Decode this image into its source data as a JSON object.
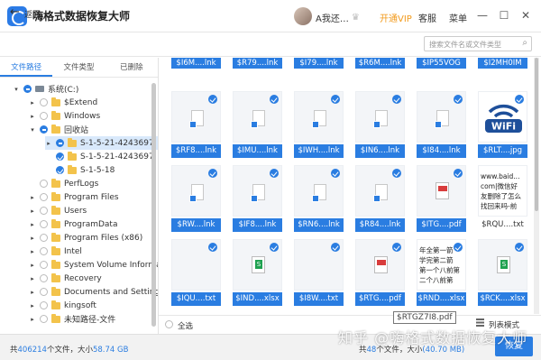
{
  "app": {
    "title": "嗨格式数据恢复大师",
    "user": "A我还…",
    "vip": "开通VIP",
    "service": "客服",
    "menu": "菜单"
  },
  "window": {
    "minimize": "—",
    "restore": "☐",
    "close": "✕"
  },
  "nav": {
    "back_label": "返回",
    "search_placeholder": "搜索文件名或文件类型"
  },
  "sidebar": {
    "tabs": [
      {
        "label": "文件路径"
      },
      {
        "label": "文件类型"
      },
      {
        "label": "已删除"
      }
    ],
    "tree": [
      {
        "label": "系统(C:)"
      },
      {
        "label": "$Extend"
      },
      {
        "label": "Windows"
      },
      {
        "label": "回收站"
      },
      {
        "label": "S-1-5-21-4243697"
      },
      {
        "label": "S-1-5-21-4243697"
      },
      {
        "label": "S-1-5-18"
      },
      {
        "label": "PerfLogs"
      },
      {
        "label": "Program Files"
      },
      {
        "label": "Users"
      },
      {
        "label": "ProgramData"
      },
      {
        "label": "Program Files (x86)"
      },
      {
        "label": "Intel"
      },
      {
        "label": "System Volume Informa"
      },
      {
        "label": "Recovery"
      },
      {
        "label": "Documents and Settings"
      },
      {
        "label": "kingsoft"
      },
      {
        "label": "未知路径-文件"
      }
    ]
  },
  "grid": {
    "top_row": [
      "$I6M....lnk",
      "$R79....lnk",
      "$I79....lnk",
      "$R6M....lnk",
      "$IP55VOG",
      "$I2MH0IM"
    ],
    "rows": [
      [
        {
          "name": "$RF8....lnk",
          "preview": ""
        },
        {
          "name": "$IMU....lnk",
          "preview": ""
        },
        {
          "name": "$IWH....lnk",
          "preview": ""
        },
        {
          "name": "$IN6....lnk",
          "preview": ""
        },
        {
          "name": "$I84....lnk",
          "preview": ""
        },
        {
          "name": "$RLT....jpg",
          "preview": "WiFi"
        }
      ],
      [
        {
          "name": "$RW....lnk",
          "preview": ""
        },
        {
          "name": "$IF8....lnk",
          "preview": ""
        },
        {
          "name": "$RN6....lnk",
          "preview": ""
        },
        {
          "name": "$R84....lnk",
          "preview": ""
        },
        {
          "name": "$ITG....pdf",
          "preview": ""
        },
        {
          "name": "$RQU....txt",
          "preview": "www.baid...\ncom|微信好\n友删除了怎么\n找回来吗-前"
        }
      ],
      [
        {
          "name": "$IQU....txt",
          "preview": ""
        },
        {
          "name": "$IND....xlsx",
          "preview": ""
        },
        {
          "name": "$I8W....txt",
          "preview": ""
        },
        {
          "name": "$RTG....pdf",
          "preview": ""
        },
        {
          "name": "$RND....xlsx",
          "preview": "年全第一箭\n学完第二箭\n第一个八前第\n二个八前第"
        },
        {
          "name": "$RCK....xlsx",
          "preview": ""
        }
      ]
    ]
  },
  "bottom": {
    "select_all": "全选",
    "tooltip": "$RTGZ7I8.pdf",
    "view_mode": "列表模式"
  },
  "status": {
    "prefix": "共",
    "total_count": "406214",
    "mid": "个文件，大小",
    "total_size": "58.74 GB",
    "right_prefix": "共",
    "sel_count": "48",
    "right_mid": "个文件，大小",
    "sel_size": "(40.70 MB)",
    "recover": "恢复"
  },
  "watermark": "知乎 @嗨格式数据恢复大师",
  "colors": {
    "accent": "#2a7de1",
    "vip": "#f29a1b"
  },
  "icons": [
    "app-logo-icon",
    "crown-icon",
    "back-arrow-icon",
    "search-icon",
    "folder-icon",
    "drive-icon",
    "check-icon",
    "shortcut-file-icon",
    "xlsx-file-icon",
    "pdf-file-icon",
    "wifi-image",
    "list-view-icon"
  ]
}
